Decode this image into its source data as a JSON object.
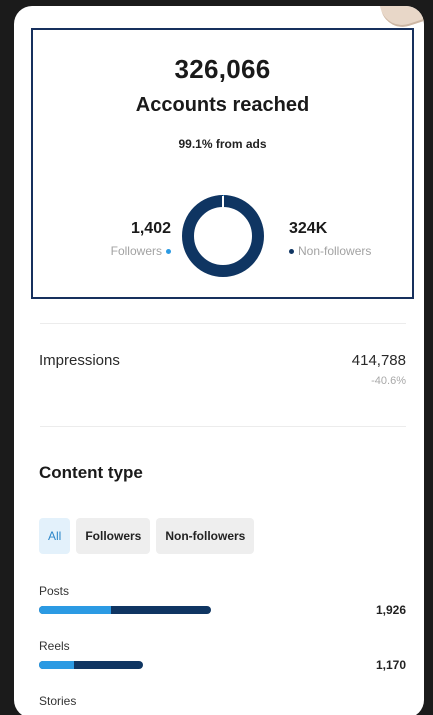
{
  "reach": {
    "total": "326,066",
    "title": "Accounts reached",
    "ads_note": "99.1% from ads",
    "followers_value": "1,402",
    "followers_label": "Followers",
    "non_followers_value": "324K",
    "non_followers_label": "Non-followers",
    "followers_share": 0.004
  },
  "impressions": {
    "label": "Impressions",
    "value": "414,788",
    "change": "-40.6%"
  },
  "content_type": {
    "title": "Content type",
    "filters": [
      {
        "label": "All",
        "active": true
      },
      {
        "label": "Followers",
        "active": false
      },
      {
        "label": "Non-followers",
        "active": false
      }
    ],
    "rows": [
      {
        "label": "Posts",
        "value": "1,926",
        "total": 1926,
        "followers_share": 0.42
      },
      {
        "label": "Reels",
        "value": "1,170",
        "total": 1170,
        "followers_share": 0.34
      },
      {
        "label": "Stories",
        "value": "",
        "total": 0,
        "followers_share": 0
      }
    ]
  },
  "colors": {
    "followers": "#2b9ae3",
    "non_followers": "#0f3562",
    "frame": "#17305d"
  }
}
